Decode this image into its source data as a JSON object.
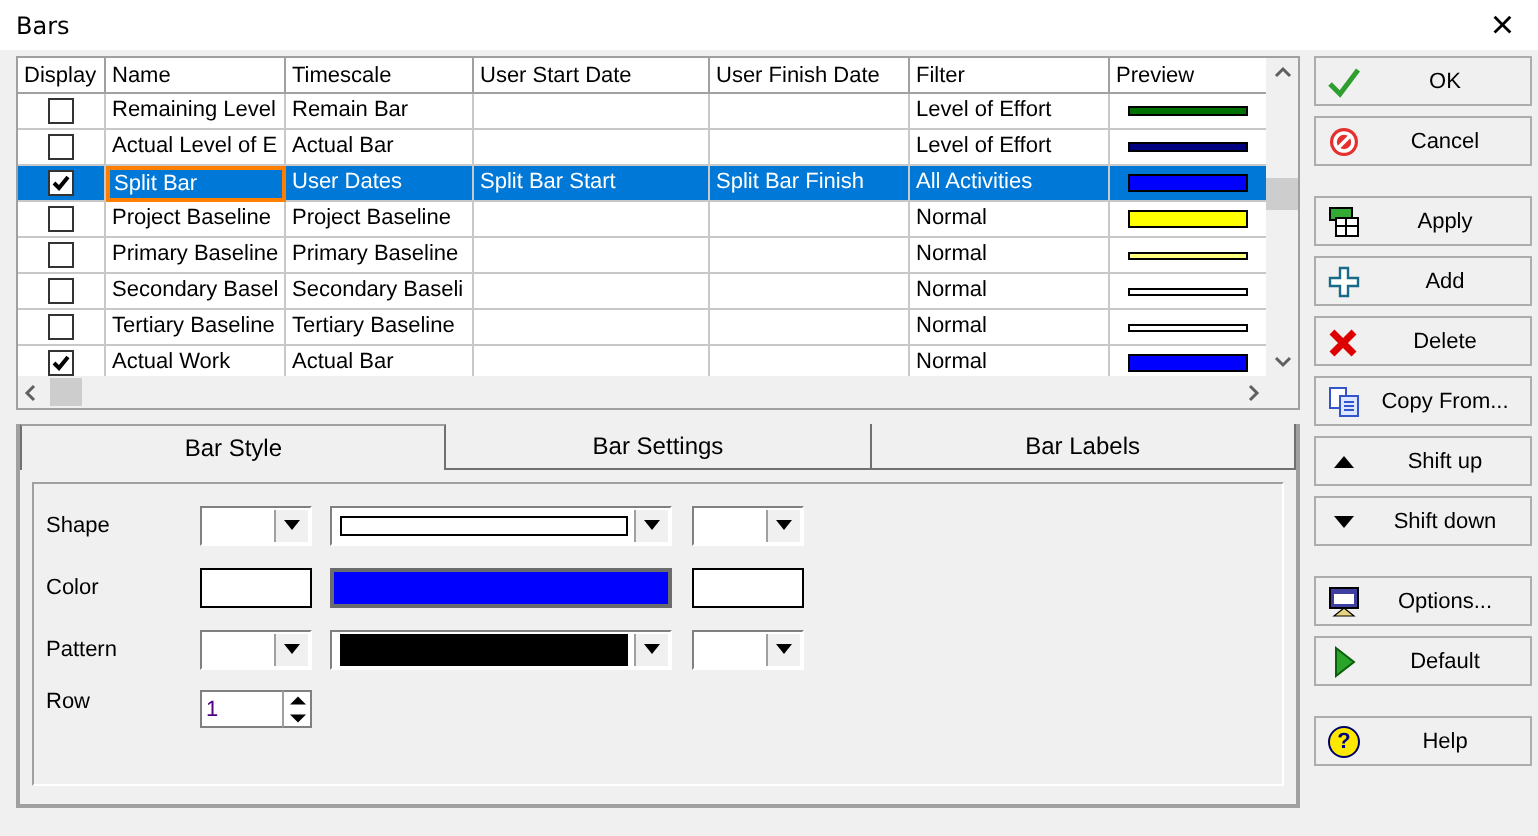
{
  "window": {
    "title": "Bars",
    "close": "×"
  },
  "table": {
    "columns": [
      "Display",
      "Name",
      "Timescale",
      "User Start Date",
      "User Finish Date",
      "Filter",
      "Preview"
    ],
    "rows": [
      {
        "display": false,
        "selected": false,
        "name": "Remaining Level",
        "timescale": "Remain Bar",
        "filter": "Level of Effort",
        "preview": {
          "kind": "thin",
          "color": "#007000"
        }
      },
      {
        "display": false,
        "selected": false,
        "name": "Actual Level of E",
        "timescale": "Actual Bar",
        "filter": "Level of Effort",
        "preview": {
          "kind": "thin",
          "color": "#000080"
        }
      },
      {
        "display": true,
        "selected": true,
        "name": "Split Bar",
        "timescale": "User Dates",
        "start": "Split Bar Start",
        "finish": "Split Bar Finish",
        "filter": "All Activities",
        "preview": {
          "kind": "thick",
          "color": "#0000ff"
        }
      },
      {
        "display": false,
        "selected": false,
        "name": "Project Baseline",
        "timescale": "Project Baseline",
        "filter": "Normal",
        "preview": {
          "kind": "thick",
          "color": "#ffff00"
        }
      },
      {
        "display": false,
        "selected": false,
        "name": "Primary Baseline",
        "timescale": "Primary Baseline",
        "filter": "Normal",
        "preview": {
          "kind": "line",
          "color": "#ffff80"
        }
      },
      {
        "display": false,
        "selected": false,
        "name": "Secondary Basel",
        "timescale": "Secondary Baseli",
        "filter": "Normal",
        "preview": {
          "kind": "line",
          "color": "#ffffff"
        }
      },
      {
        "display": false,
        "selected": false,
        "name": "Tertiary Baseline",
        "timescale": "Tertiary Baseline",
        "filter": "Normal",
        "preview": {
          "kind": "line",
          "color": "#ffffff"
        }
      },
      {
        "display": true,
        "selected": false,
        "name": "Actual Work",
        "timescale": "Actual Bar",
        "filter": "Normal",
        "preview": {
          "kind": "thick",
          "color": "#0000ff"
        }
      }
    ]
  },
  "tabs": [
    {
      "label": "Bar Style",
      "selected": true
    },
    {
      "label": "Bar Settings",
      "selected": false
    },
    {
      "label": "Bar Labels",
      "selected": false
    }
  ],
  "bar_style": [
    {
      "label": "Shape",
      "kind": "dropdowns",
      "fields": [
        {
          "kind": "blank"
        },
        {
          "kind": "outline"
        },
        {
          "kind": "blank"
        }
      ]
    },
    {
      "label": "Color",
      "kind": "swatches",
      "fields": [
        {
          "color": "#ffffff"
        },
        {
          "color": "#0000ff"
        },
        {
          "color": "#ffffff"
        }
      ]
    },
    {
      "label": "Pattern",
      "kind": "dropdowns",
      "fields": [
        {
          "kind": "blank"
        },
        {
          "kind": "solid"
        },
        {
          "kind": "blank"
        }
      ]
    },
    {
      "label": "Row",
      "kind": "spinner",
      "value": "1"
    }
  ],
  "button_groups": [
    [
      {
        "label": "OK",
        "kind": "check"
      },
      {
        "label": "Cancel",
        "kind": "cancel"
      }
    ],
    [
      {
        "label": "Apply",
        "kind": "apply"
      },
      {
        "label": "Add",
        "kind": "add"
      },
      {
        "label": "Delete",
        "kind": "delete"
      },
      {
        "label": "Copy From...",
        "kind": "copy"
      },
      {
        "label": "Shift up",
        "kind": "up"
      },
      {
        "label": "Shift down",
        "kind": "down"
      }
    ],
    [
      {
        "label": "Options...",
        "kind": "options"
      },
      {
        "label": "Default",
        "kind": "play"
      }
    ],
    [
      {
        "label": "Help",
        "kind": "help",
        "glyph": "?"
      }
    ]
  ]
}
